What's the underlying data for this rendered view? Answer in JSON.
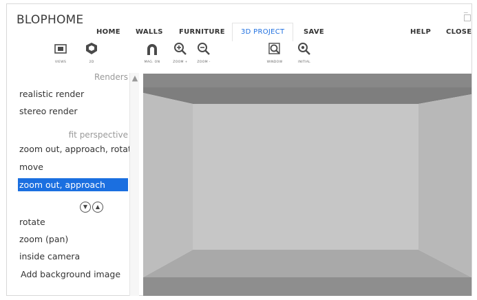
{
  "app": {
    "title": "BLOPHOME"
  },
  "window": {
    "minimize": "_",
    "maximize": ""
  },
  "nav": {
    "home": "HOME",
    "walls": "WALLS",
    "furniture": "FURNITURE",
    "project3d": "3D PROJECT",
    "save": "SAVE",
    "help": "HELP",
    "close": "CLOSE"
  },
  "toolbar": {
    "views": "VIEWS",
    "twod": "2D",
    "magon": "MAG. ON",
    "zoomin": "ZOOM +",
    "zoomout": "ZOOM -",
    "window": "WINDOW",
    "initial": "INITIAL"
  },
  "sidebar": {
    "renders_heading": "Renders",
    "realistic": "realistic render",
    "stereo": "stereo render",
    "fit_heading": "fit perspective",
    "zoom_out_rotate": "zoom out, approach, rotate",
    "move": "move",
    "zoom_out_approach": "zoom out, approach",
    "rotate": "rotate",
    "zoom_pan": "zoom (pan)",
    "inside_camera": "inside camera",
    "add_background": "Add background image"
  },
  "colors": {
    "accent": "#1e6fe0",
    "selection": "#1b6fe0",
    "icon_dark": "#4a4a4a"
  }
}
